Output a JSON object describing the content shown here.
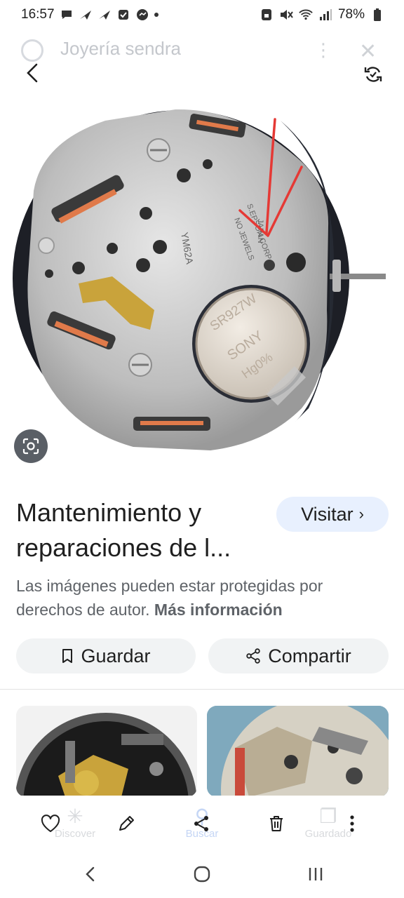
{
  "status_bar": {
    "time": "16:57",
    "battery": "78%"
  },
  "header": {
    "site_name": "Joyería sendra"
  },
  "watch_image": {
    "stamped_text": [
      "JAPAN",
      "S.EPSON CORP",
      "NO JEWELS",
      "YM62A",
      "SR927W",
      "SONY",
      "Hg0%",
      "JAPAN"
    ]
  },
  "result": {
    "title": "Mantenimiento y reparaciones de l...",
    "visit_label": "Visitar",
    "copyright_text": "Las imágenes pueden estar protegidas por derechos de autor.",
    "more_info": "Más información"
  },
  "actions": {
    "save_label": "Guardar",
    "share_label": "Compartir"
  },
  "background_nav": {
    "discover": "Discover",
    "search": "Buscar",
    "saved": "Guardado"
  },
  "icons": {
    "back": "back-arrow-icon",
    "rotate": "rotate-icon",
    "lens": "lens-icon",
    "bookmark": "bookmark-icon",
    "share": "share-icon",
    "heart": "heart-icon",
    "edit": "pencil-icon",
    "delete": "trash-icon",
    "more": "more-vert-icon"
  },
  "colors": {
    "visit_bg": "#e8f0fe",
    "pill_bg": "#f1f3f4",
    "annotation": "#e53935"
  }
}
